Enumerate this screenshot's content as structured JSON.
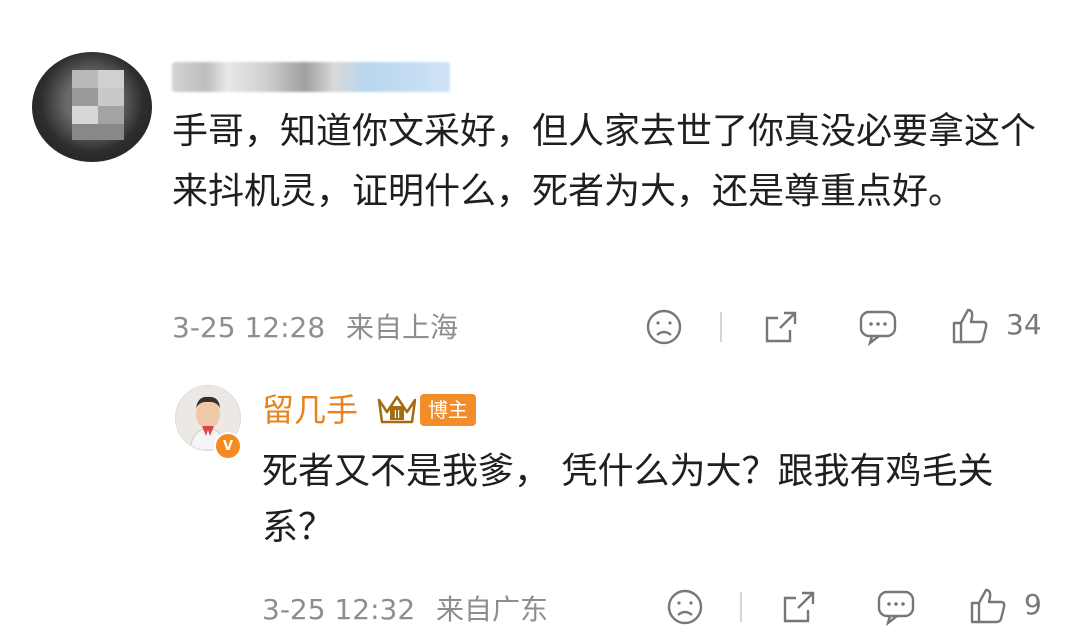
{
  "comment": {
    "text": "手哥，知道你文采好，但人家去世了你真没必要拿这个来抖机灵，证明什么，死者为大，还是尊重点好。",
    "date": "3-25 12:28",
    "location": "来自上海",
    "like_count": "34"
  },
  "reply": {
    "author": "留几手",
    "badge": "博主",
    "text": "死者又不是我爹， 凭什么为大？跟我有鸡毛关系？",
    "date": "3-25 12:32",
    "location": "来自广东",
    "like_count": "9",
    "avatar_badge": "V"
  },
  "colors": {
    "accent_orange": "#e9821c",
    "meta_gray": "#8e8e8e",
    "text": "#1f1f1f"
  },
  "icons": [
    "sad-face-icon",
    "share-icon",
    "comment-icon",
    "thumbs-up-icon",
    "crown-icon"
  ]
}
